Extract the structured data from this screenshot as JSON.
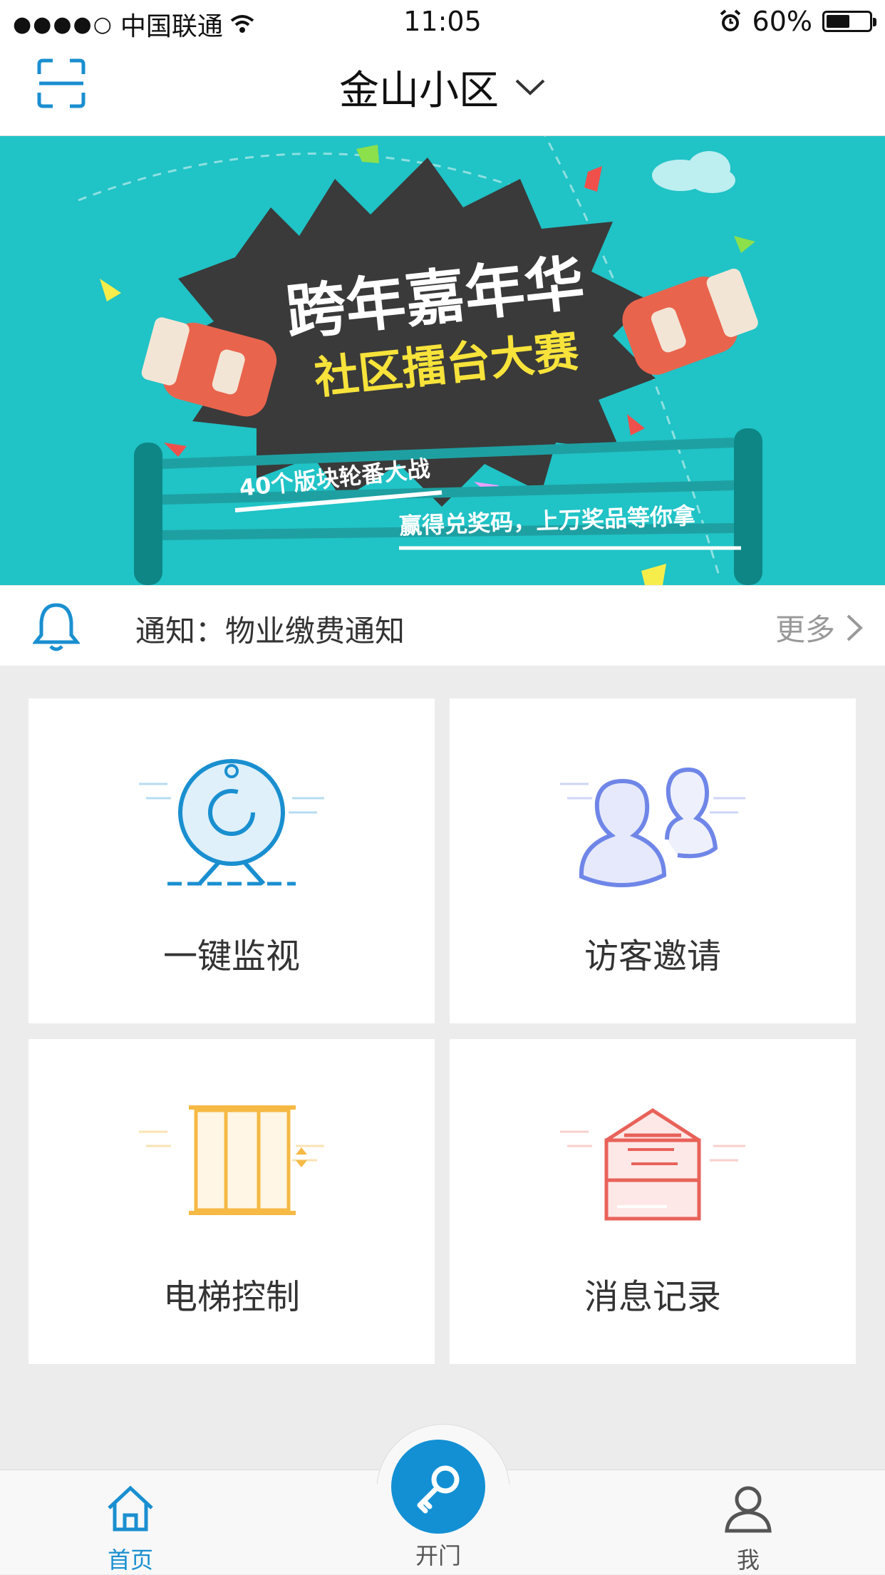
{
  "status_bar": {
    "signal": "●●●●○",
    "carrier": "中国联通",
    "time": "11:05",
    "battery": "60%",
    "battery_level": 0.6
  },
  "nav": {
    "title": "金山小区"
  },
  "banner": {
    "title": "跨年嘉年华",
    "subtitle": "社区擂台大赛",
    "line1": "40个版块轮番大战",
    "line2": "赢得兑奖码，上万奖品等你拿"
  },
  "notice": {
    "text": "通知：物业缴费通知",
    "more_label": "更多"
  },
  "grid": [
    {
      "label": "一键监视",
      "icon": "camera-icon",
      "color": "#1a8fd0"
    },
    {
      "label": "访客邀请",
      "icon": "visitors-icon",
      "color": "#6f86e8"
    },
    {
      "label": "电梯控制",
      "icon": "elevator-icon",
      "color": "#f5b944"
    },
    {
      "label": "消息记录",
      "icon": "mail-icon",
      "color": "#e8625a"
    }
  ],
  "tabs": [
    {
      "label": "首页",
      "icon": "home-icon",
      "color": "#1a8fd0"
    },
    {
      "label": "开门",
      "icon": "key-icon",
      "color": "#555555"
    },
    {
      "label": "我",
      "icon": "user-icon",
      "color": "#555555"
    }
  ]
}
